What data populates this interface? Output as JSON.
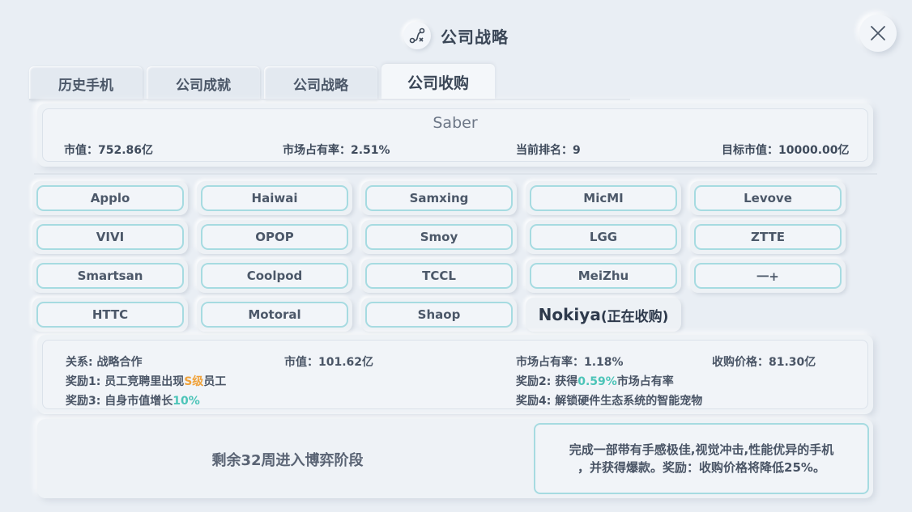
{
  "header": {
    "title": "公司战略",
    "icon": "strategy-icon"
  },
  "tabs": [
    {
      "label": "历史手机",
      "active": false
    },
    {
      "label": "公司成就",
      "active": false
    },
    {
      "label": "公司战略",
      "active": false
    },
    {
      "label": "公司收购",
      "active": true
    }
  ],
  "company": {
    "name": "Saber",
    "market_value": "市值：752.86亿",
    "market_share": "市场占有率：2.51%",
    "rank": "当前排名：9",
    "target_value": "目标市值：10000.00亿"
  },
  "brands": [
    "Applo",
    "Haiwai",
    "Samxing",
    "MicMI",
    "Levove",
    "VIVI",
    "OPOP",
    "Smoy",
    "LGG",
    "ZTTE",
    "Smartsan",
    "Coolpod",
    "TCCL",
    "MeiZhu",
    "一+",
    "HTTC",
    "Motoral",
    "Shaop"
  ],
  "current_target": {
    "name": "Nokiya",
    "status": "(正在收购)"
  },
  "target_info": {
    "relation": "关系: 战略合作",
    "market_value": "市值：101.62亿",
    "market_share": "市场占有率：1.18%",
    "price": "收购价格：81.30亿",
    "reward1_prefix": "奖励1: 员工竞聘里出现",
    "reward1_highlight": "S级",
    "reward1_suffix": "员工",
    "reward2_prefix": "奖励2: 获得",
    "reward2_highlight": "0.59%",
    "reward2_suffix": "市场占有率",
    "reward3_prefix": "奖励3: 自身市值增长",
    "reward3_highlight": "10%",
    "reward4": "奖励4: 解锁硬件生态系统的智能宠物"
  },
  "countdown": "剩余32周进入博弈阶段",
  "task": {
    "line1": "完成一部带有手感极佳,视觉冲击,性能优异的手机",
    "line2": "，并获得爆款。奖励：收购价格将降低25%。"
  },
  "colors": {
    "accent_teal": "#4cc4b8",
    "accent_orange": "#f0a23a",
    "button_border": "#a6dbe1",
    "background": "#e9eef4"
  }
}
